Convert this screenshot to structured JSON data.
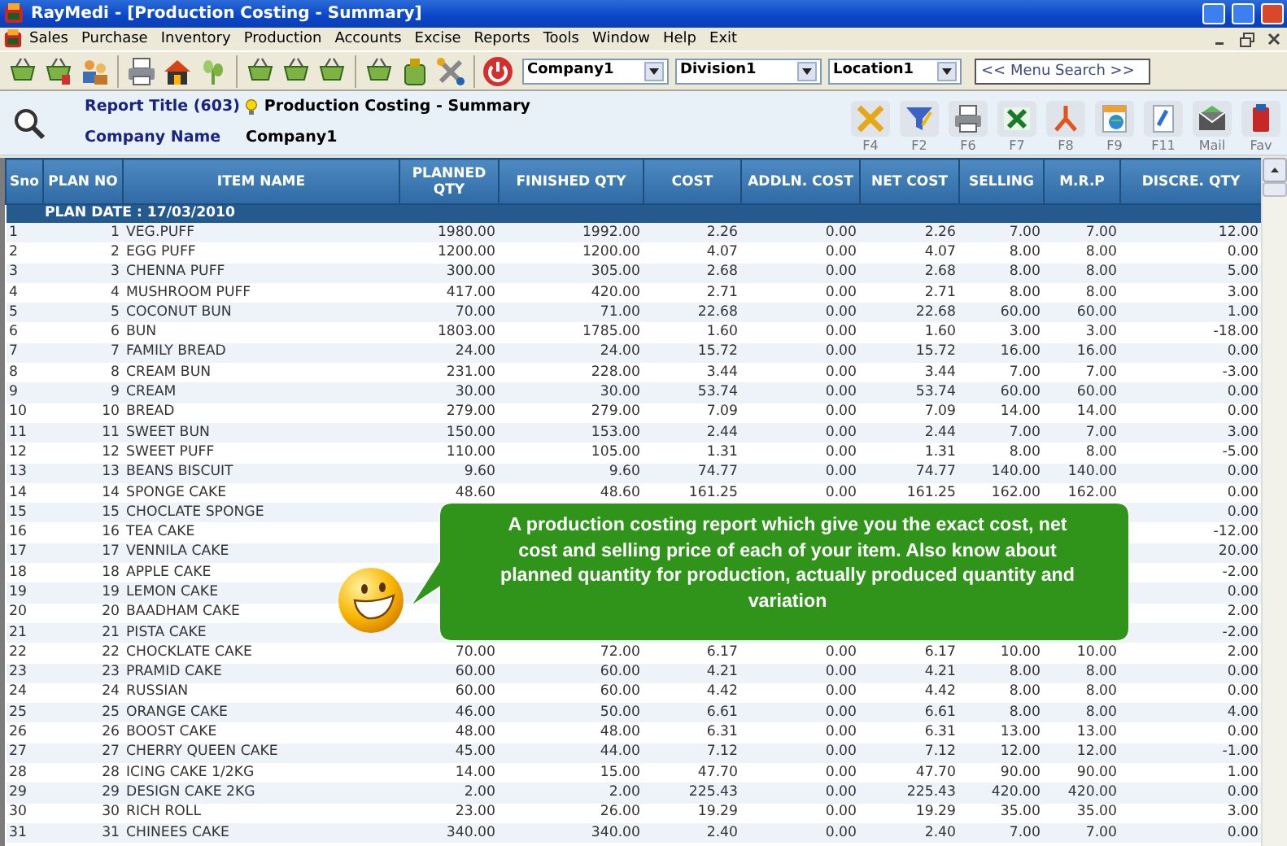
{
  "window": {
    "title": "RayMedi - [Production Costing - Summary]"
  },
  "menu": [
    "Sales",
    "Purchase",
    "Inventory",
    "Production",
    "Accounts",
    "Excise",
    "Reports",
    "Tools",
    "Window",
    "Help",
    "Exit"
  ],
  "toolbar": {
    "company": "Company1",
    "division": "Division1",
    "location": "Location1",
    "search": {
      "placeholder": "<< Menu Search >>"
    }
  },
  "report": {
    "title_label": "Report Title (603)",
    "title": "Production Costing - Summary",
    "company_label": "Company Name",
    "company": "Company1",
    "actions": [
      "F4",
      "F2",
      "F6",
      "F7",
      "F8",
      "F9",
      "F11",
      "Mail",
      "Fav"
    ]
  },
  "table": {
    "columns": [
      "Sno",
      "PLAN NO",
      "ITEM NAME",
      "PLANNED QTY",
      "FINISHED QTY",
      "COST",
      "ADDLN. COST",
      "NET COST",
      "SELLING",
      "M.R.P",
      "DISCRE. QTY"
    ],
    "group": "PLAN DATE : 17/03/2010",
    "rows": [
      [
        "1",
        "1",
        "VEG.PUFF",
        "1980.00",
        "1992.00",
        "2.26",
        "0.00",
        "2.26",
        "7.00",
        "7.00",
        "12.00"
      ],
      [
        "2",
        "2",
        "EGG PUFF",
        "1200.00",
        "1200.00",
        "4.07",
        "0.00",
        "4.07",
        "8.00",
        "8.00",
        "0.00"
      ],
      [
        "3",
        "3",
        "CHENNA PUFF",
        "300.00",
        "305.00",
        "2.68",
        "0.00",
        "2.68",
        "8.00",
        "8.00",
        "5.00"
      ],
      [
        "4",
        "4",
        "MUSHROOM PUFF",
        "417.00",
        "420.00",
        "2.71",
        "0.00",
        "2.71",
        "8.00",
        "8.00",
        "3.00"
      ],
      [
        "5",
        "5",
        "COCONUT BUN",
        "70.00",
        "71.00",
        "22.68",
        "0.00",
        "22.68",
        "60.00",
        "60.00",
        "1.00"
      ],
      [
        "6",
        "6",
        "BUN",
        "1803.00",
        "1785.00",
        "1.60",
        "0.00",
        "1.60",
        "3.00",
        "3.00",
        "-18.00"
      ],
      [
        "7",
        "7",
        "FAMILY BREAD",
        "24.00",
        "24.00",
        "15.72",
        "0.00",
        "15.72",
        "16.00",
        "16.00",
        "0.00"
      ],
      [
        "8",
        "8",
        "CREAM BUN",
        "231.00",
        "228.00",
        "3.44",
        "0.00",
        "3.44",
        "7.00",
        "7.00",
        "-3.00"
      ],
      [
        "9",
        "9",
        "CREAM",
        "30.00",
        "30.00",
        "53.74",
        "0.00",
        "53.74",
        "60.00",
        "60.00",
        "0.00"
      ],
      [
        "10",
        "10",
        "BREAD",
        "279.00",
        "279.00",
        "7.09",
        "0.00",
        "7.09",
        "14.00",
        "14.00",
        "0.00"
      ],
      [
        "11",
        "11",
        "SWEET BUN",
        "150.00",
        "153.00",
        "2.44",
        "0.00",
        "2.44",
        "7.00",
        "7.00",
        "3.00"
      ],
      [
        "12",
        "12",
        "SWEET PUFF",
        "110.00",
        "105.00",
        "1.31",
        "0.00",
        "1.31",
        "8.00",
        "8.00",
        "-5.00"
      ],
      [
        "13",
        "13",
        "BEANS BISCUIT",
        "9.60",
        "9.60",
        "74.77",
        "0.00",
        "74.77",
        "140.00",
        "140.00",
        "0.00"
      ],
      [
        "14",
        "14",
        "SPONGE CAKE",
        "48.60",
        "48.60",
        "161.25",
        "0.00",
        "161.25",
        "162.00",
        "162.00",
        "0.00"
      ],
      [
        "15",
        "15",
        "CHOCLATE SPONGE",
        null,
        null,
        null,
        null,
        null,
        null,
        null,
        "0.00"
      ],
      [
        "16",
        "16",
        "TEA CAKE",
        null,
        null,
        null,
        null,
        null,
        null,
        null,
        "-12.00"
      ],
      [
        "17",
        "17",
        "VENNILA CAKE",
        null,
        null,
        null,
        null,
        null,
        null,
        null,
        "20.00"
      ],
      [
        "18",
        "18",
        "APPLE CAKE",
        null,
        null,
        null,
        null,
        null,
        null,
        null,
        "-2.00"
      ],
      [
        "19",
        "19",
        "LEMON CAKE",
        null,
        null,
        null,
        null,
        null,
        null,
        null,
        "0.00"
      ],
      [
        "20",
        "20",
        "BAADHAM CAKE",
        null,
        null,
        null,
        null,
        null,
        null,
        null,
        "2.00"
      ],
      [
        "21",
        "21",
        "PISTA CAKE",
        null,
        null,
        null,
        null,
        null,
        null,
        null,
        "-2.00"
      ],
      [
        "22",
        "22",
        "CHOCKLATE CAKE",
        "70.00",
        "72.00",
        "6.17",
        "0.00",
        "6.17",
        "10.00",
        "10.00",
        "2.00"
      ],
      [
        "23",
        "23",
        "PRAMID CAKE",
        "60.00",
        "60.00",
        "4.21",
        "0.00",
        "4.21",
        "8.00",
        "8.00",
        "0.00"
      ],
      [
        "24",
        "24",
        "RUSSIAN",
        "60.00",
        "60.00",
        "4.42",
        "0.00",
        "4.42",
        "8.00",
        "8.00",
        "0.00"
      ],
      [
        "25",
        "25",
        "ORANGE CAKE",
        "46.00",
        "50.00",
        "6.61",
        "0.00",
        "6.61",
        "8.00",
        "8.00",
        "4.00"
      ],
      [
        "26",
        "26",
        "BOOST CAKE",
        "48.00",
        "48.00",
        "6.31",
        "0.00",
        "6.31",
        "13.00",
        "13.00",
        "0.00"
      ],
      [
        "27",
        "27",
        "CHERRY QUEEN CAKE",
        "45.00",
        "44.00",
        "7.12",
        "0.00",
        "7.12",
        "12.00",
        "12.00",
        "-1.00"
      ],
      [
        "28",
        "28",
        "ICING CAKE 1/2KG",
        "14.00",
        "15.00",
        "47.70",
        "0.00",
        "47.70",
        "90.00",
        "90.00",
        "1.00"
      ],
      [
        "29",
        "29",
        "DESIGN CAKE 2KG",
        "2.00",
        "2.00",
        "225.43",
        "0.00",
        "225.43",
        "420.00",
        "420.00",
        "0.00"
      ],
      [
        "30",
        "30",
        "RICH ROLL",
        "23.00",
        "26.00",
        "19.29",
        "0.00",
        "19.29",
        "35.00",
        "35.00",
        "3.00"
      ],
      [
        "31",
        "31",
        "CHINEES CAKE",
        "340.00",
        "340.00",
        "2.40",
        "0.00",
        "2.40",
        "7.00",
        "7.00",
        "0.00"
      ]
    ]
  },
  "callout": {
    "text": "A production costing report which give you the exact cost, net cost and selling price of each of your item. Also know about planned quantity for production, actually produced quantity and variation"
  }
}
